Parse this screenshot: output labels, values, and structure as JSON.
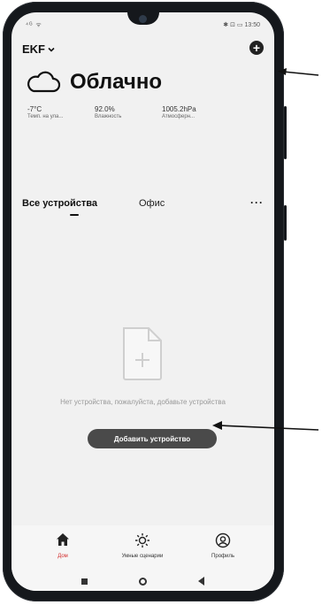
{
  "status_bar": {
    "left": "⁴ᴳ ᯤ",
    "right": "✱ ⊡ ▭ 13:50"
  },
  "header": {
    "home_name": "EKF",
    "home_chevron": "chevron-down-icon",
    "add_icon": "plus-circle-icon"
  },
  "weather": {
    "icon": "cloud-icon",
    "condition": "Облачно",
    "metrics": [
      {
        "value": "-7°C",
        "label": "Темп. на ула..."
      },
      {
        "value": "92.0%",
        "label": "Влажность"
      },
      {
        "value": "1005.2hPa",
        "label": "Атмосферн..."
      }
    ]
  },
  "room_tabs": {
    "items": [
      "Все устройства",
      "Офис"
    ],
    "active_index": 0,
    "more_icon": "more-horizontal-icon"
  },
  "empty_state": {
    "icon": "file-add-icon",
    "message": "Нет устройства, пожалуйста, добавьте устройства",
    "button_label": "Добавить устройство"
  },
  "bottom_tabs": [
    {
      "icon": "home-icon",
      "label": "Дом",
      "active": true
    },
    {
      "icon": "sun-icon",
      "label": "Умные сценарии",
      "active": false
    },
    {
      "icon": "profile-icon",
      "label": "Профиль",
      "active": false
    }
  ],
  "colors": {
    "screen_bg": "#f1f1f1",
    "button_bg": "#4a4a4a",
    "active_tab": "#d32f2f",
    "phone_body": "#15181c"
  }
}
